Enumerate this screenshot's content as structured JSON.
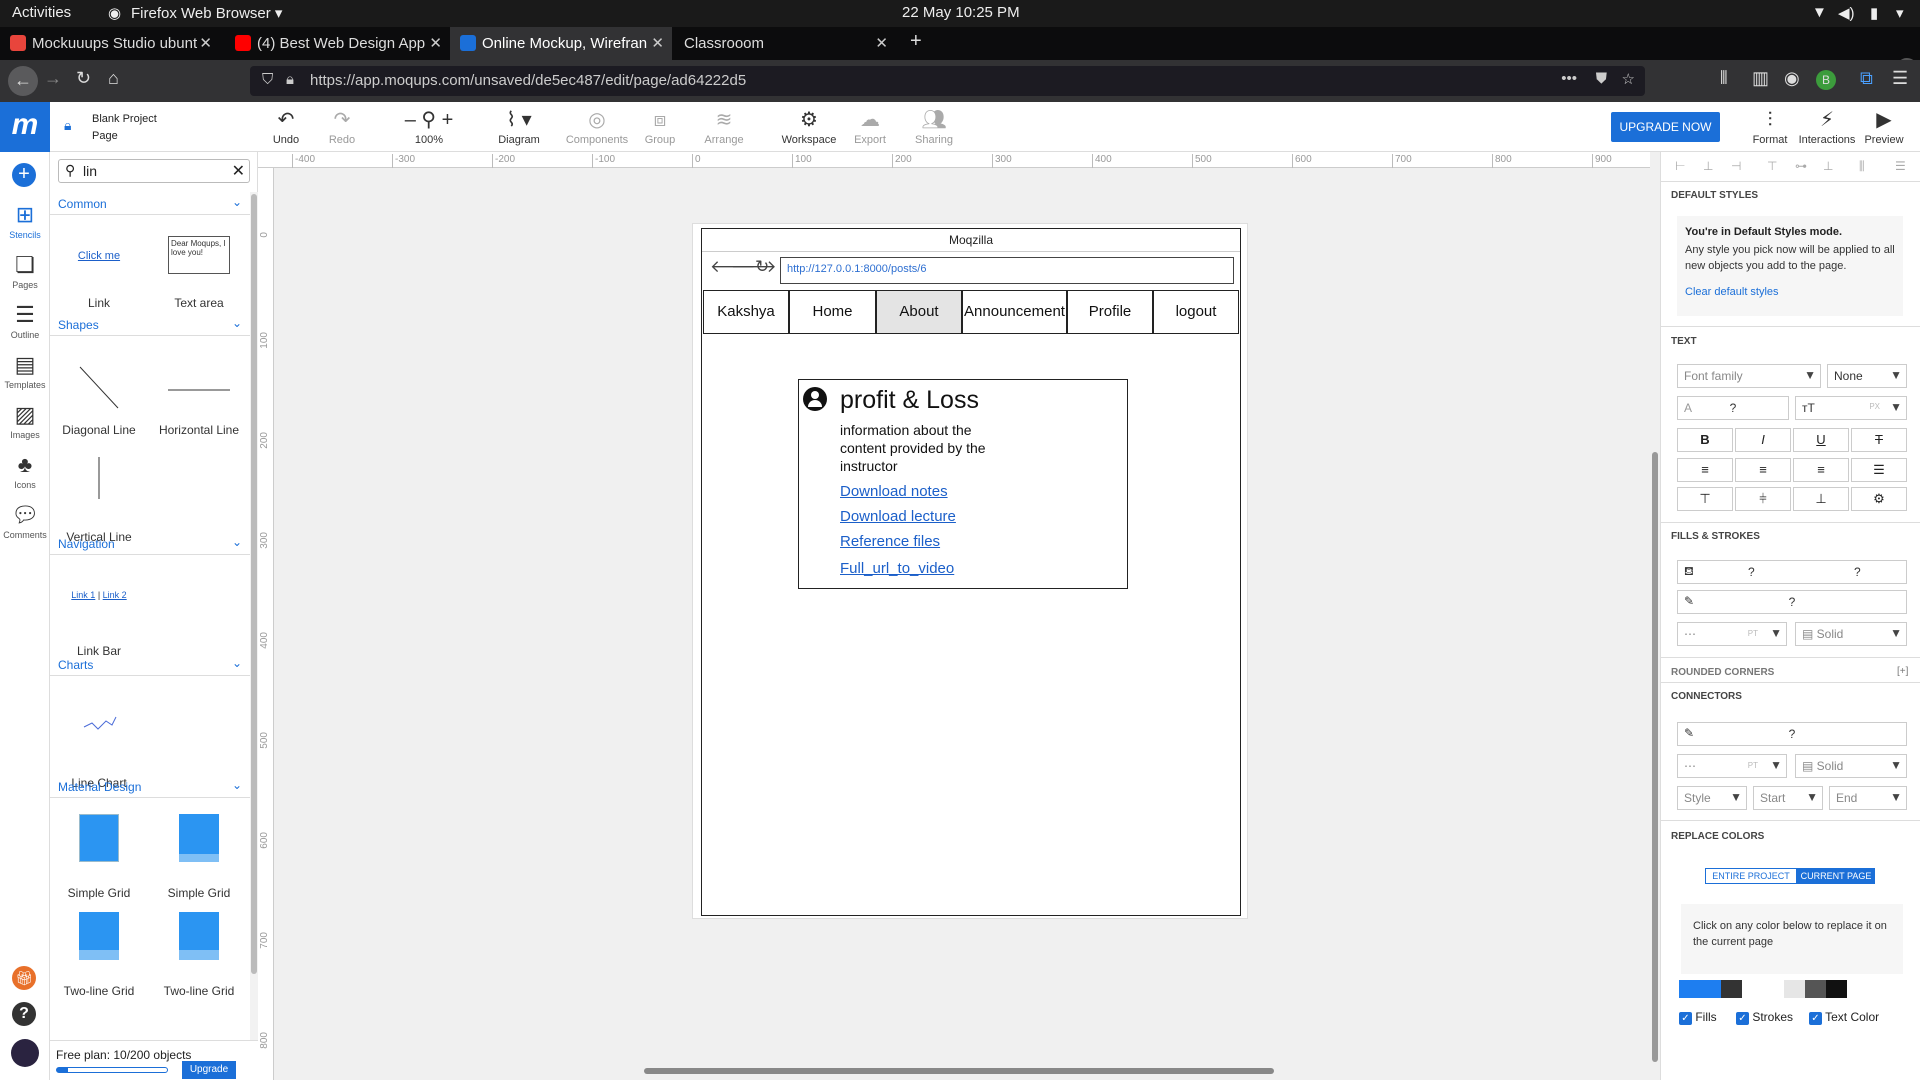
{
  "os": {
    "activities": "Activities",
    "app": "Firefox Web Browser",
    "clock": "22 May  10:25 PM"
  },
  "tabs": [
    {
      "label": "Mockuuups Studio ubunt",
      "color": "#e8453c"
    },
    {
      "label": "(4) Best Web Design App",
      "color": "#ff0000"
    },
    {
      "label": "Online Mockup, Wirefran",
      "color": "#1b6fd8"
    },
    {
      "label": "Classrooom",
      "color": ""
    }
  ],
  "url": "https://app.moqups.com/unsaved/de5ec487/edit/page/ad64222d5",
  "project": {
    "title": "Blank Project",
    "page": "Page"
  },
  "toolbar": {
    "undo": "Undo",
    "redo": "Redo",
    "zoom": "100%",
    "diagram": "Diagram",
    "components": "Components",
    "group": "Group",
    "arrange": "Arrange",
    "workspace": "Workspace",
    "export": "Export",
    "sharing": "Sharing",
    "upgrade": "UPGRADE NOW",
    "format": "Format",
    "interactions": "Interactions",
    "preview": "Preview"
  },
  "rail": [
    "Stencils",
    "Pages",
    "Outline",
    "Templates",
    "Images",
    "Icons",
    "Comments"
  ],
  "search": {
    "value": "lin"
  },
  "sections": {
    "common": "Common",
    "shapes": "Shapes",
    "navigation": "Navigation",
    "charts": "Charts",
    "material": "Material Design"
  },
  "stencils": {
    "link": "Link",
    "link_preview": "Click me",
    "textarea": "Text area",
    "textarea_preview": "Dear Moqups, I love you!",
    "diag": "Diagonal Line",
    "horiz": "Horizontal Line",
    "vert": "Vertical Line",
    "linkbar": "Link Bar",
    "linkbar_preview1": "Link 1",
    "linkbar_preview2": "Link 2",
    "linechart": "Line Chart",
    "grid1": "Simple Grid",
    "grid2": "Simple Grid",
    "grid3": "Two-line Grid",
    "grid4": "Two-line Grid"
  },
  "plan": {
    "text": "Free plan: 10/200 objects",
    "upgrade": "Upgrade"
  },
  "ruler_h": [
    "-400",
    "-300",
    "-200",
    "-100",
    "0",
    "100",
    "200",
    "300",
    "400",
    "500",
    "600",
    "700",
    "800",
    "900"
  ],
  "ruler_v": [
    "0",
    "100",
    "200",
    "300",
    "400",
    "500",
    "600",
    "700",
    "800"
  ],
  "mock": {
    "title": "Moqzilla",
    "url": "http://127.0.0.1:8000/posts/6",
    "nav": [
      "Kakshya",
      "Home",
      "About",
      "Announcement",
      "Profile",
      "logout"
    ],
    "card": {
      "title": "profit & Loss",
      "desc": "information about the content provided by the instructor",
      "links": [
        "Download notes",
        "Download lecture",
        "Reference files",
        "Full_url_to_video"
      ]
    }
  },
  "right": {
    "default_styles": "DEFAULT STYLES",
    "mode_title": "You're in Default Styles mode.",
    "mode_desc": "Any style you pick now will be applied to all new objects you add to the page.",
    "clear": "Clear default styles",
    "text": "TEXT",
    "font_family": "Font family",
    "none": "None",
    "q": "?",
    "px": "PX",
    "fills": "FILLS & STROKES",
    "pt": "PT",
    "solid": "Solid",
    "rounded": "ROUNDED CORNERS",
    "plus": "[+]",
    "connectors": "CONNECTORS",
    "style": "Style",
    "start": "Start",
    "end": "End",
    "replace": "REPLACE COLORS",
    "entire": "ENTIRE PROJECT",
    "current": "CURRENT PAGE",
    "click_desc": "Click on any color below to replace it on the current page",
    "cb_fills": "Fills",
    "cb_strokes": "Strokes",
    "cb_text": "Text Color",
    "swatches": [
      "#1e7ef0",
      "#1e7ef0",
      "#333333",
      "#ffffff",
      "#ffffff",
      "#e6e6e6",
      "#555555",
      "#111111"
    ]
  }
}
